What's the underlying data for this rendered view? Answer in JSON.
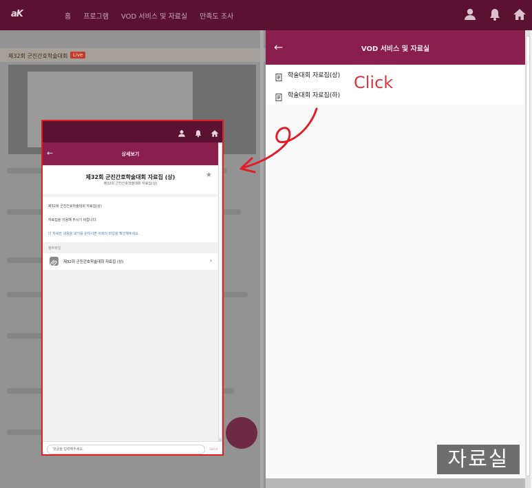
{
  "header": {
    "logo_text": "aK",
    "nav": [
      "홈",
      "프로그램",
      "VOD 서비스 및 자료실",
      "만족도 조사"
    ],
    "icons": [
      "user-icon",
      "bell-icon",
      "home-icon"
    ]
  },
  "background": {
    "live_title": "제32회 군진간호학술대회",
    "live_badge": "Live"
  },
  "panel": {
    "title": "VOD 서비스 및 자료실",
    "back_icon": "←",
    "items": [
      {
        "label": "학술대회 자료집(상)",
        "icon": "document-icon"
      },
      {
        "label": "학술대회 자료집(하)",
        "icon": "document-icon"
      }
    ]
  },
  "annotation": {
    "click_text": "Click",
    "color": "#d93640"
  },
  "inset": {
    "header_title": "상세보기",
    "back_icon": "←",
    "doc_title": "제32회 군진간호학술대회 자료집 (상)",
    "doc_subtitle": "제32회 군진간호학술대회 자료집(상)",
    "star": "★",
    "body_lines": [
      "제32회 군진간호학술대회 자료집(상)",
      "자료집을 이용해 주시기 바랍니다.",
      "더 자세한 내용을 보기를 원하시면 아래의 파일을 확인해주세요."
    ],
    "attachment_label": "첨부파일",
    "attachment_name": "제32회 군진간호학술대회 자료집 (상)",
    "chevron": "›",
    "comment_placeholder": "댓글을 입력해주세요.",
    "send_label": "Send"
  },
  "caption": "자료실",
  "colors": {
    "nav_bg": "#5a1230",
    "header_bg": "#8a1f4d",
    "highlight": "#e01e28"
  }
}
